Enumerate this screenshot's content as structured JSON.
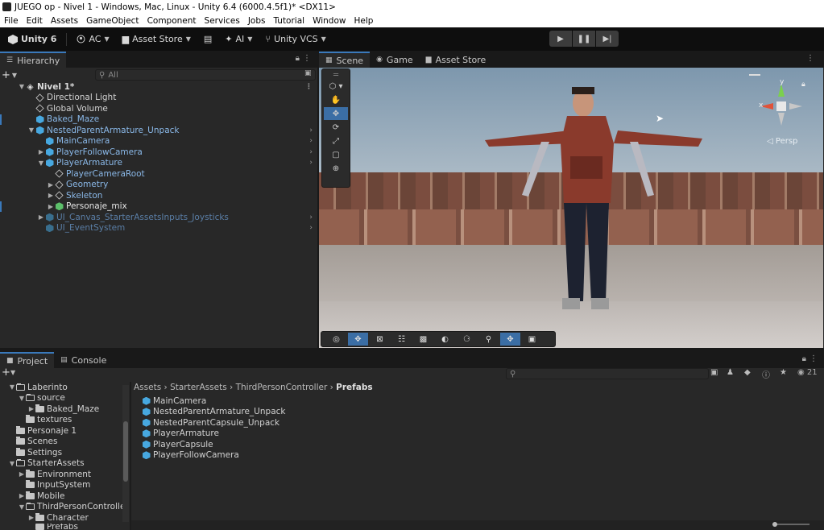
{
  "window": {
    "title": "JUEGO op - Nivel 1 - Windows, Mac, Linux - Unity 6.4 (6000.4.5f1)* <DX11>"
  },
  "menu": [
    "File",
    "Edit",
    "Assets",
    "GameObject",
    "Component",
    "Services",
    "Jobs",
    "Tutorial",
    "Window",
    "Help"
  ],
  "toolbar": {
    "unity_label": "Unity 6",
    "account_label": "AC",
    "assetstore_label": "Asset Store",
    "ai_label": "AI",
    "vcs_label": "Unity VCS"
  },
  "hierarchy": {
    "tab": "Hierarchy",
    "search_placeholder": "All",
    "scene_name": "Nivel 1*",
    "items": [
      {
        "label": "Directional Light"
      },
      {
        "label": "Global Volume"
      },
      {
        "label": "Baked_Maze"
      },
      {
        "label": "NestedParentArmature_Unpack"
      },
      {
        "label": "MainCamera"
      },
      {
        "label": "PlayerFollowCamera"
      },
      {
        "label": "PlayerArmature"
      },
      {
        "label": "PlayerCameraRoot"
      },
      {
        "label": "Geometry"
      },
      {
        "label": "Skeleton"
      },
      {
        "label": "Personaje_mix"
      },
      {
        "label": "UI_Canvas_StarterAssetsInputs_Joysticks"
      },
      {
        "label": "UI_EventSystem"
      }
    ]
  },
  "scene": {
    "tabs": [
      "Scene",
      "Game",
      "Asset Store"
    ],
    "persp_label": "Persp",
    "gizmo": {
      "x": "x",
      "y": "y"
    }
  },
  "project": {
    "tabs": [
      "Project",
      "Console"
    ],
    "count": "21",
    "breadcrumb": [
      "Assets",
      "StarterAssets",
      "ThirdPersonController",
      "Prefabs"
    ],
    "tree": [
      {
        "label": "Laberinto"
      },
      {
        "label": "source"
      },
      {
        "label": "Baked_Maze"
      },
      {
        "label": "textures"
      },
      {
        "label": "Personaje 1"
      },
      {
        "label": "Scenes"
      },
      {
        "label": "Settings"
      },
      {
        "label": "StarterAssets"
      },
      {
        "label": "Environment"
      },
      {
        "label": "InputSystem"
      },
      {
        "label": "Mobile"
      },
      {
        "label": "ThirdPersonController"
      },
      {
        "label": "Character"
      },
      {
        "label": "Prefabs"
      }
    ],
    "assets": [
      {
        "label": "MainCamera"
      },
      {
        "label": "NestedParentArmature_Unpack"
      },
      {
        "label": "NestedParentCapsule_Unpack"
      },
      {
        "label": "PlayerArmature"
      },
      {
        "label": "PlayerCapsule"
      },
      {
        "label": "PlayerFollowCamera"
      }
    ]
  }
}
